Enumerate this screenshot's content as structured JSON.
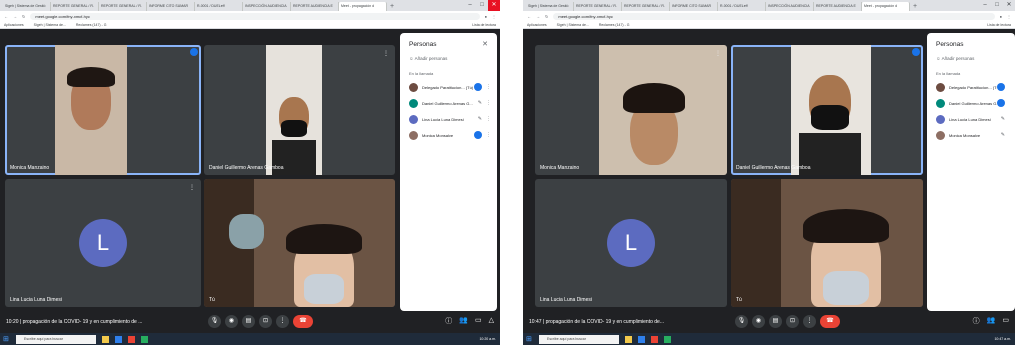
{
  "browser": {
    "tabs": [
      "Sigeh | Sistema de Gestió",
      "REPORTE GENERAL / R.",
      "REPORTE GENERAL / R.",
      "INFORME CITO SUMAR",
      "R-0001 / DUELeff",
      "INSPECCIÓN AUDIENCIA",
      "REPORTE AUDIENCIA E",
      "Meet - propagación d"
    ],
    "new_tab": "+",
    "url": "meet.google.com/fny-xmcf-hyc",
    "bookmarks": [
      "Aplicaciones",
      "Sigeh | Sistema de...",
      "Reclames (147) - G"
    ],
    "reading_list": "Lista de lectura"
  },
  "participants": {
    "monica": "Monica Manzaino",
    "daniel": "Daniel Guillermo Arenas Gamboa",
    "lina": "Lina Lucia Luna Dimesi",
    "tu": "Tú",
    "lina_initial": "L"
  },
  "panel": {
    "title": "Personas",
    "close": "✕",
    "add": "Añadir personas",
    "section": "En la llamada",
    "rows": [
      {
        "name": "Delegado Paratitucion... (Tú)",
        "color": "#6d4c41"
      },
      {
        "name": "Daniel Guillermo Arenas G...",
        "color": "#00897b"
      },
      {
        "name": "Lina Lucia Luna Dimesi",
        "color": "#5c6bc0"
      },
      {
        "name": "Monica Monsalve",
        "color": "#8d6e63"
      }
    ]
  },
  "meeting": {
    "left": {
      "time": "10:20",
      "title": "propagación de la COVID- 19 y en cumplimiento de ..."
    },
    "right": {
      "time": "10:47",
      "title": "propagación de la COVID- 19 y en cumplimiento de..."
    }
  },
  "taskbar": {
    "search": "Escribe aquí para buscar",
    "clock_left": "10:20 a.m.",
    "clock_right": "10:47 a.m."
  },
  "colors": {
    "accent": "#8ab4f8",
    "end_call": "#ea4335",
    "surface": "#202124",
    "tile": "#3c4043"
  }
}
